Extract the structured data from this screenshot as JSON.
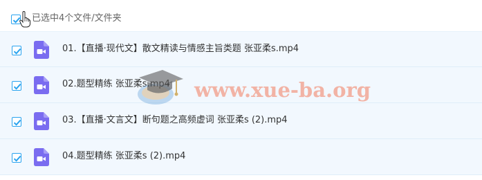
{
  "header": {
    "select_all_checked": true,
    "selection_label": "已选中4个文件/文件夹"
  },
  "files": [
    {
      "name": "01.【直播·现代文】散文精读与情感主旨类题 张亚柔s.mp4",
      "checked": true,
      "icon": "video-file-icon"
    },
    {
      "name": "02.题型精练 张亚柔s.mp4",
      "checked": true,
      "icon": "video-file-icon"
    },
    {
      "name": "03.【直播·文言文】断句题之高频虚词 张亚柔s (2).mp4",
      "checked": true,
      "icon": "video-file-icon"
    },
    {
      "name": "04.题型精练 张亚柔s (2).mp4",
      "checked": true,
      "icon": "video-file-icon"
    }
  ],
  "watermark": {
    "text": "www.xue-ba.org"
  },
  "colors": {
    "checkbox": "#29a3ef",
    "row_background": "#f2f8fe",
    "file_icon": "#7a6cf0"
  }
}
